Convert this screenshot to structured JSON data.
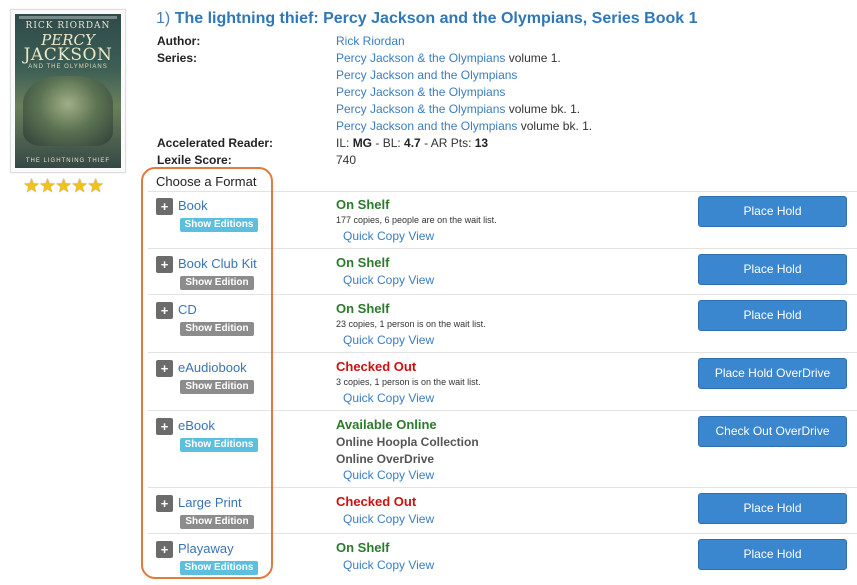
{
  "cover": {
    "author": "RICK RIORDAN",
    "title_line1": "PERCY",
    "title_line2": "JACKSON",
    "title_line3": "AND THE OLYMPIANS",
    "bottom_title": "THE LIGHTNING THIEF"
  },
  "rating": {
    "stars": "★★★★★",
    "value": 5,
    "max": 5
  },
  "title": {
    "number": "1)",
    "text": "The lightning thief: Percy Jackson and the Olympians, Series Book 1"
  },
  "info": {
    "author_label": "Author:",
    "author": "Rick Riordan",
    "series_label": "Series:",
    "series": [
      {
        "link": "Percy Jackson & the Olympians",
        "suffix": " volume 1."
      },
      {
        "link": "Percy Jackson and the Olympians",
        "suffix": ""
      },
      {
        "link": "Percy Jackson & the Olympians",
        "suffix": ""
      },
      {
        "link": "Percy Jackson & the Olympians",
        "suffix": " volume bk. 1."
      },
      {
        "link": "Percy Jackson and the Olympians",
        "suffix": " volume bk. 1."
      }
    ],
    "ar_label": "Accelerated Reader:",
    "ar": {
      "il_prefix": "IL: ",
      "il": "MG",
      "bl_prefix": " - BL: ",
      "bl": "4.7",
      "pts_prefix": " - AR Pts: ",
      "pts": "13"
    },
    "lexile_label": "Lexile Score:",
    "lexile": "740"
  },
  "choose_format": "Choose a Format",
  "plus": "+",
  "quick_copy": "Quick Copy View",
  "formats": [
    {
      "name": "Book",
      "editions": "Show Editions",
      "status": "On Shelf",
      "copies": "177 copies, 6 people are on the wait list.",
      "action": "Place Hold"
    },
    {
      "name": "Book Club Kit",
      "editions": "Show Edition",
      "status": "On Shelf",
      "copies": "",
      "action": "Place Hold"
    },
    {
      "name": "CD",
      "editions": "Show Edition",
      "status": "On Shelf",
      "copies": "23 copies, 1 person is on the wait list.",
      "action": "Place Hold"
    },
    {
      "name": "eAudiobook",
      "editions": "Show Edition",
      "status": "Checked Out",
      "copies": "3 copies, 1 person is on the wait list.",
      "action": "Place Hold OverDrive"
    },
    {
      "name": "eBook",
      "editions": "Show Editions",
      "status": "Available Online",
      "sources": [
        "Online Hoopla Collection",
        "Online OverDrive"
      ],
      "action": "Check Out OverDrive"
    },
    {
      "name": "Large Print",
      "editions": "Show Edition",
      "status": "Checked Out",
      "copies": "",
      "action": "Place Hold"
    },
    {
      "name": "Playaway",
      "editions": "Show Editions",
      "status": "On Shelf",
      "copies": "",
      "action": "Place Hold"
    }
  ],
  "colors": {
    "link": "#3b7dbf",
    "on_shelf": "#2c7a2c",
    "checked_out": "#cc1111",
    "button": "#3a87d0",
    "highlight": "#e07a3e"
  }
}
